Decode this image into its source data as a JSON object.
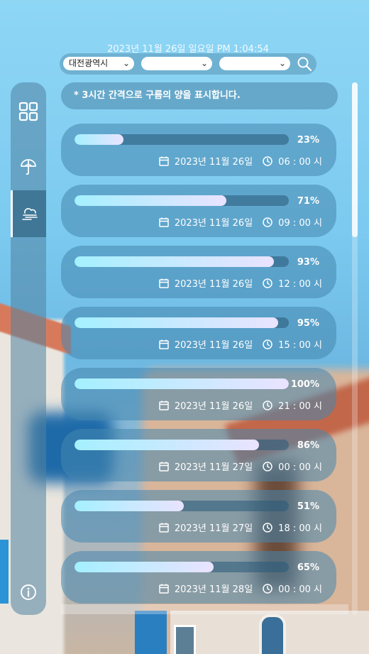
{
  "header": {
    "datetime": "2023년 11월 26일 일요일 PM 1:04:54"
  },
  "selects": [
    {
      "value": "대전광역시"
    },
    {
      "value": ""
    },
    {
      "value": ""
    }
  ],
  "notice": "* 3시간 간격으로 구름의 양을 표시합니다.",
  "sidebar": {
    "items": [
      {
        "icon": "grid-icon",
        "active": false
      },
      {
        "icon": "umbrella-icon",
        "active": false
      },
      {
        "icon": "cloud-wind-icon",
        "active": true
      }
    ],
    "footer_icon": "info-icon"
  },
  "cards": [
    {
      "percent": 23,
      "pct_label": "23%",
      "date": "2023년 11월  26일",
      "time": "06 : 00 시"
    },
    {
      "percent": 71,
      "pct_label": "71%",
      "date": "2023년 11월  26일",
      "time": "09 : 00 시"
    },
    {
      "percent": 93,
      "pct_label": "93%",
      "date": "2023년 11월  26일",
      "time": "12 : 00 시"
    },
    {
      "percent": 95,
      "pct_label": "95%",
      "date": "2023년 11월  26일",
      "time": "15 : 00 시"
    },
    {
      "percent": 100,
      "pct_label": "100%",
      "date": "2023년 11월  26일",
      "time": "21 : 00 시"
    },
    {
      "percent": 86,
      "pct_label": "86%",
      "date": "2023년 11월  27일",
      "time": "00 : 00 시"
    },
    {
      "percent": 51,
      "pct_label": "51%",
      "date": "2023년 11월  27일",
      "time": "18 : 00 시"
    },
    {
      "percent": 65,
      "pct_label": "65%",
      "date": "2023년 11월  28일",
      "time": "00 : 00 시"
    }
  ],
  "colors": {
    "bar_start": "#a4f0ff",
    "bar_end": "#eae3ff"
  }
}
